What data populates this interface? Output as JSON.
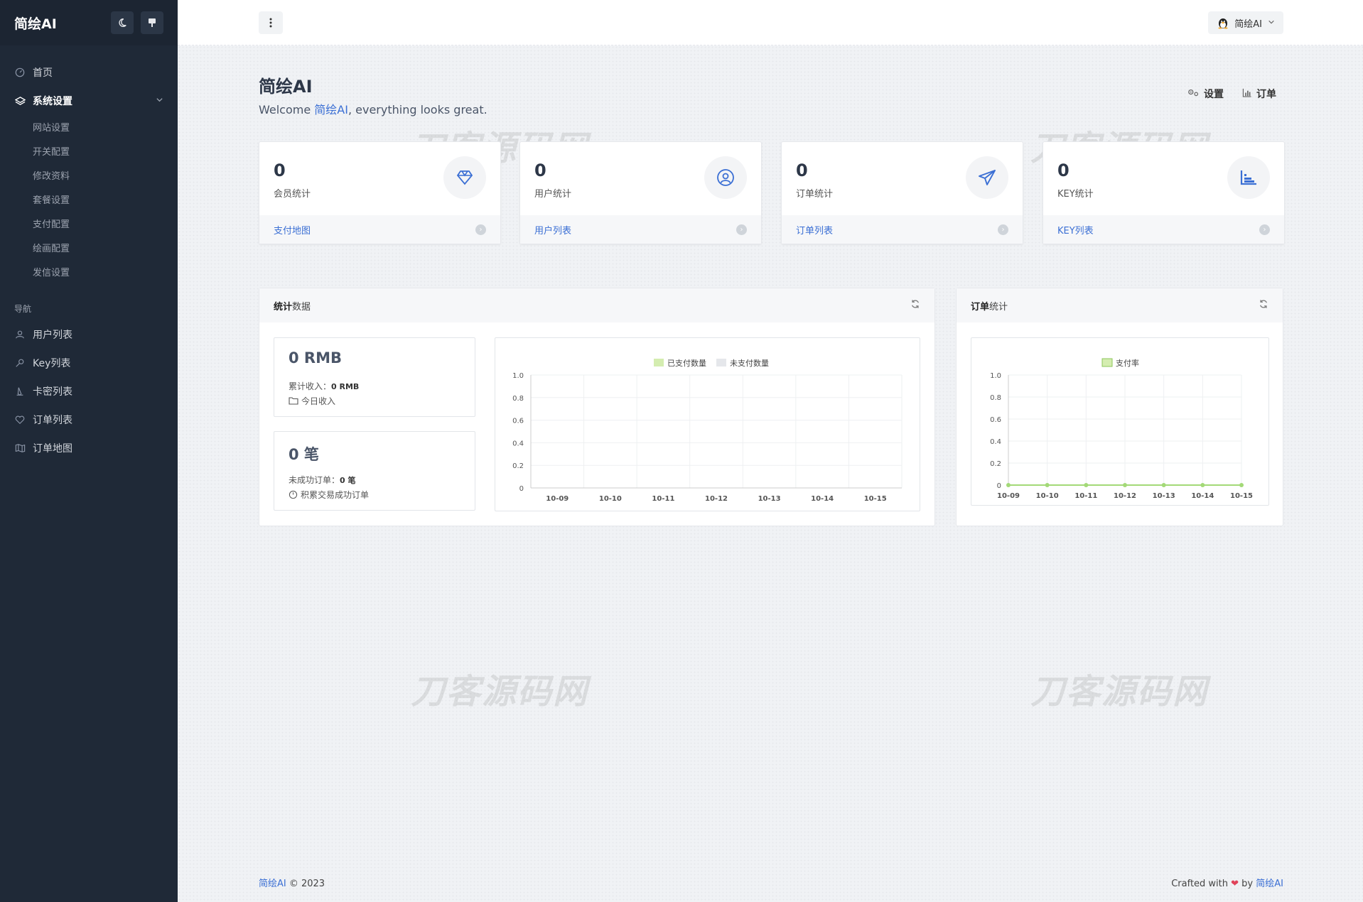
{
  "sidebar": {
    "brand": "简绘AI",
    "theme_icon": "moon-icon",
    "pin_icon": "pin-icon",
    "items_top": [
      {
        "label": "首页",
        "icon": "dashboard-icon"
      },
      {
        "label": "系统设置",
        "icon": "layers-icon"
      }
    ],
    "sub_items": [
      "网站设置",
      "开关配置",
      "修改资料",
      "套餐设置",
      "支付配置",
      "绘画配置",
      "发信设置"
    ],
    "nav_heading": "导航",
    "nav_items": [
      {
        "label": "用户列表",
        "icon": "user-icon"
      },
      {
        "label": "Key列表",
        "icon": "key-icon"
      },
      {
        "label": "卡密列表",
        "icon": "pen-icon"
      },
      {
        "label": "订单列表",
        "icon": "heart-icon"
      },
      {
        "label": "订单地图",
        "icon": "map-icon"
      }
    ]
  },
  "header": {
    "menu_icon": "more-vertical-icon",
    "user_name": "简绘AI"
  },
  "page": {
    "title": "简绘AI",
    "welcome_prefix": "Welcome ",
    "welcome_name": "简绘AI",
    "welcome_suffix": ", everything looks great.",
    "quick_settings": "设置",
    "quick_orders": "订单"
  },
  "watermark": "刀客源码网",
  "stat_cards": [
    {
      "value": "0",
      "label": "会员统计",
      "link": "支付地图",
      "icon": "diamond-icon"
    },
    {
      "value": "0",
      "label": "用户统计",
      "link": "用户列表",
      "icon": "user-circle-icon"
    },
    {
      "value": "0",
      "label": "订单统计",
      "link": "订单列表",
      "icon": "send-icon"
    },
    {
      "value": "0",
      "label": "KEY统计",
      "link": "KEY列表",
      "icon": "bar-chart-icon"
    }
  ],
  "stats_panel": {
    "title_bold": "统计",
    "title_rest": "数据",
    "revenue_big": "0 RMB",
    "revenue_total_label": "累计收入：",
    "revenue_total_value": "0 RMB",
    "revenue_today": "今日收入",
    "orders_big": "0 笔",
    "orders_failed_label": "未成功订单：",
    "orders_failed_value": "0 笔",
    "orders_success": "积累交易成功订单"
  },
  "orders_panel": {
    "title_bold": "订单",
    "title_rest": "统计"
  },
  "footer": {
    "brand": "简绘AI",
    "copyright": " © 2023",
    "crafted": "Crafted with ",
    "by": " by ",
    "author": "简绘AI"
  },
  "colors": {
    "sidebar": "#1f2937",
    "accent": "#3b6fd4",
    "series_paid": "#d4edb0",
    "series_unpaid": "#e5e7eb",
    "series_rate": "#a3d977"
  },
  "chart_data": [
    {
      "type": "bar",
      "categories": [
        "10-09",
        "10-10",
        "10-11",
        "10-12",
        "10-13",
        "10-14",
        "10-15"
      ],
      "series": [
        {
          "name": "已支付数量",
          "values": [
            0,
            0,
            0,
            0,
            0,
            0,
            0
          ]
        },
        {
          "name": "未支付数量",
          "values": [
            0,
            0,
            0,
            0,
            0,
            0,
            0
          ]
        }
      ],
      "ylim": [
        0,
        1
      ],
      "yticks": [
        "1.0",
        "0.8",
        "0.6",
        "0.4",
        "0.2",
        "0"
      ],
      "grid": true,
      "legend": "top-center"
    },
    {
      "type": "line",
      "categories": [
        "10-09",
        "10-10",
        "10-11",
        "10-12",
        "10-13",
        "10-14",
        "10-15"
      ],
      "series": [
        {
          "name": "支付率",
          "values": [
            0,
            0,
            0,
            0,
            0,
            0,
            0
          ]
        }
      ],
      "ylim": [
        0,
        1
      ],
      "yticks": [
        "1.0",
        "0.8",
        "0.6",
        "0.4",
        "0.2",
        "0"
      ],
      "grid": true,
      "legend": "top-center"
    }
  ]
}
